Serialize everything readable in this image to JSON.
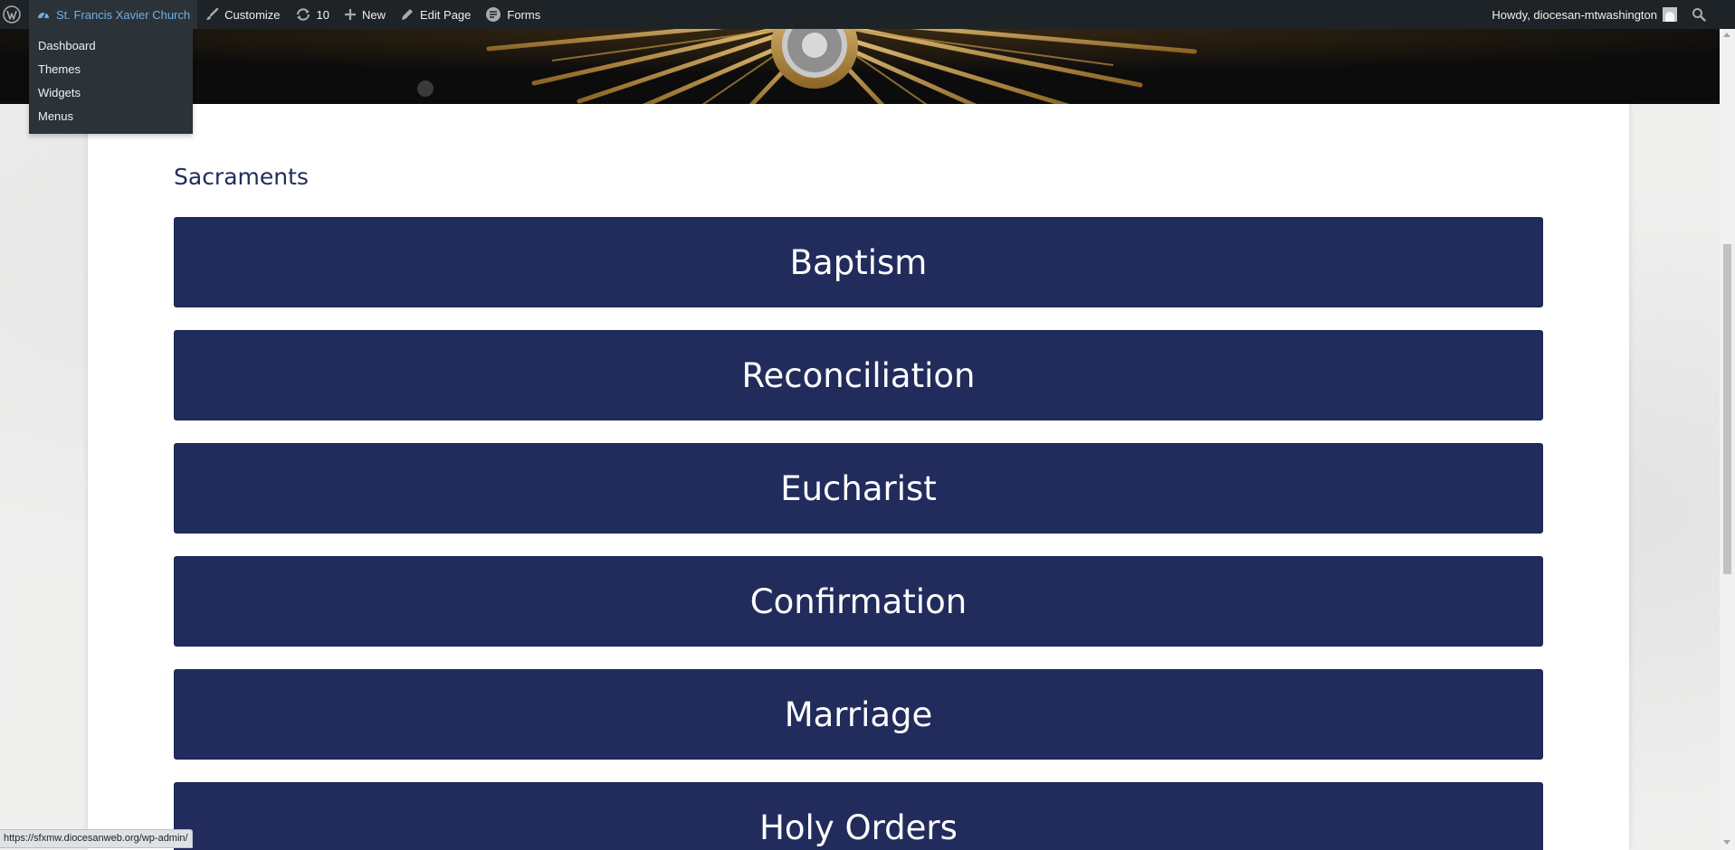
{
  "adminbar": {
    "site_name": "St. Francis Xavier Church",
    "customize": "Customize",
    "updates_count": "10",
    "new": "New",
    "edit_page": "Edit Page",
    "forms": "Forms",
    "howdy": "Howdy, diocesan-mtwashington"
  },
  "site_menu": {
    "items": [
      "Dashboard",
      "Themes",
      "Widgets",
      "Menus"
    ]
  },
  "main": {
    "section_title": "Sacraments",
    "sacraments": [
      "Baptism",
      "Reconciliation",
      "Eucharist",
      "Confirmation",
      "Marriage",
      "Holy Orders"
    ]
  },
  "status_url": "https://sfxmw.diocesanweb.org/wp-admin/",
  "colors": {
    "button_bg": "#222c5c",
    "admin_bar": "#1d2327",
    "site_link": "#72aee6"
  },
  "icons": {
    "wp_logo": "wordpress-logo-icon",
    "site": "dashboard-gauge-icon",
    "customize": "paintbrush-icon",
    "updates": "refresh-icon",
    "new": "plus-icon",
    "edit": "pencil-icon",
    "forms": "forms-icon",
    "search": "search-icon"
  }
}
